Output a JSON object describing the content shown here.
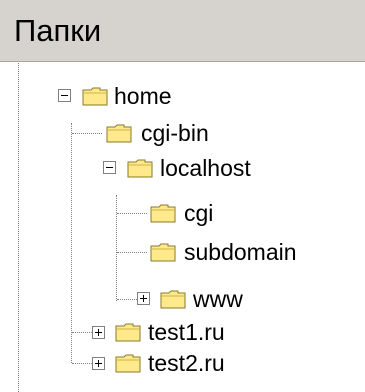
{
  "panel": {
    "title": "Папки"
  },
  "tree": {
    "items": [
      {
        "label": "home",
        "expander": "minus",
        "icon": "folder-icon"
      },
      {
        "label": "cgi-bin",
        "expander": "none",
        "icon": "folder-icon"
      },
      {
        "label": "localhost",
        "expander": "minus",
        "icon": "folder-icon"
      },
      {
        "label": "cgi",
        "expander": "none",
        "icon": "folder-icon"
      },
      {
        "label": "subdomain",
        "expander": "none",
        "icon": "folder-icon"
      },
      {
        "label": "www",
        "expander": "plus",
        "icon": "folder-icon"
      },
      {
        "label": "test1.ru",
        "expander": "plus",
        "icon": "folder-icon"
      },
      {
        "label": "test2.ru",
        "expander": "plus",
        "icon": "folder-icon"
      }
    ]
  },
  "colors": {
    "header_bg": "#d6d3ce",
    "folder_fill": "#ffe98a",
    "folder_outline": "#8a7a2a",
    "tree_line": "#808080"
  }
}
